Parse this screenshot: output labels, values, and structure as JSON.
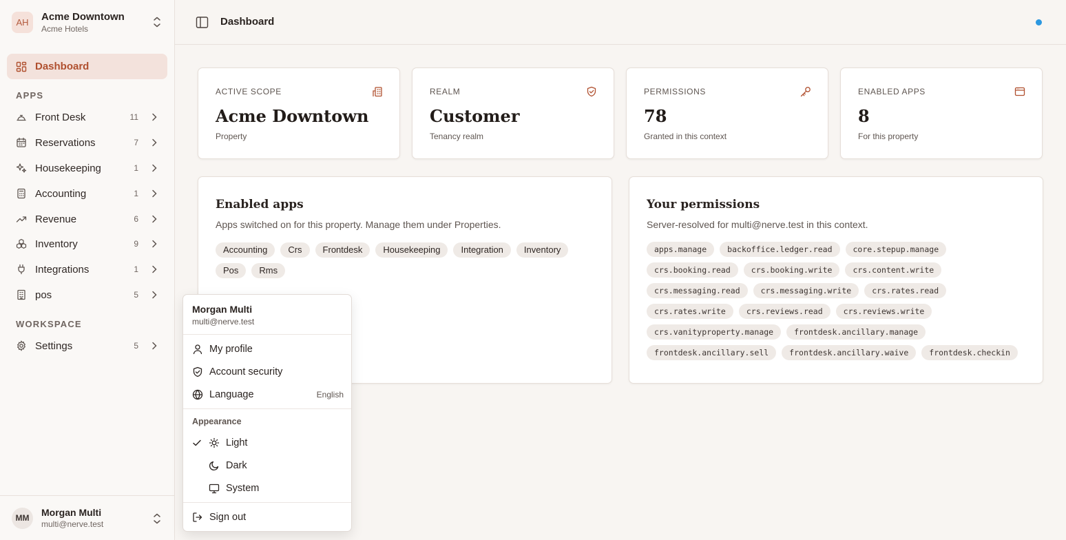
{
  "org": {
    "initials": "AH",
    "name": "Acme Downtown",
    "sub": "Acme Hotels"
  },
  "nav": {
    "dashboard": "Dashboard",
    "apps_label": "APPS",
    "apps": [
      {
        "label": "Front Desk",
        "count": "11",
        "icon": "bell-icon"
      },
      {
        "label": "Reservations",
        "count": "7",
        "icon": "calendar-icon"
      },
      {
        "label": "Housekeeping",
        "count": "1",
        "icon": "sparkles-icon"
      },
      {
        "label": "Accounting",
        "count": "1",
        "icon": "calculator-icon"
      },
      {
        "label": "Revenue",
        "count": "6",
        "icon": "trending-up-icon"
      },
      {
        "label": "Inventory",
        "count": "9",
        "icon": "boxes-icon"
      },
      {
        "label": "Integrations",
        "count": "1",
        "icon": "plug-icon"
      },
      {
        "label": "pos",
        "count": "5",
        "icon": "building-icon"
      }
    ],
    "workspace_label": "WORKSPACE",
    "settings": {
      "label": "Settings",
      "count": "5"
    }
  },
  "user": {
    "initials": "MM",
    "name": "Morgan Multi",
    "email": "multi@nerve.test"
  },
  "header": {
    "title": "Dashboard"
  },
  "stats": [
    {
      "label": "ACTIVE SCOPE",
      "value": "Acme Downtown",
      "sub": "Property",
      "icon": "building-icon"
    },
    {
      "label": "REALM",
      "value": "Customer",
      "sub": "Tenancy realm",
      "icon": "shield-check-icon"
    },
    {
      "label": "PERMISSIONS",
      "value": "78",
      "sub": "Granted in this context",
      "icon": "key-icon"
    },
    {
      "label": "ENABLED APPS",
      "value": "8",
      "sub": "For this property",
      "icon": "app-window-icon"
    }
  ],
  "enabled_apps": {
    "title": "Enabled apps",
    "desc": "Apps switched on for this property. Manage them under Properties.",
    "chips": [
      "Accounting",
      "Crs",
      "Frontdesk",
      "Housekeeping",
      "Integration",
      "Inventory",
      "Pos",
      "Rms"
    ]
  },
  "permissions": {
    "title": "Your permissions",
    "desc": "Server-resolved for multi@nerve.test in this context.",
    "chips": [
      "apps.manage",
      "backoffice.ledger.read",
      "core.stepup.manage",
      "crs.booking.read",
      "crs.booking.write",
      "crs.content.write",
      "crs.messaging.read",
      "crs.messaging.write",
      "crs.rates.read",
      "crs.rates.write",
      "crs.reviews.read",
      "crs.reviews.write",
      "crs.vanityproperty.manage",
      "frontdesk.ancillary.manage",
      "frontdesk.ancillary.sell",
      "frontdesk.ancillary.waive",
      "frontdesk.checkin"
    ]
  },
  "menu": {
    "name": "Morgan Multi",
    "email": "multi@nerve.test",
    "profile": "My profile",
    "security": "Account security",
    "language": "Language",
    "language_value": "English",
    "appearance": "Appearance",
    "light": "Light",
    "dark": "Dark",
    "system": "System",
    "signout": "Sign out"
  },
  "colors": {
    "accent": "#b0502f",
    "accent_bg": "#f3e2dc",
    "status_dot": "#2c98e0"
  }
}
